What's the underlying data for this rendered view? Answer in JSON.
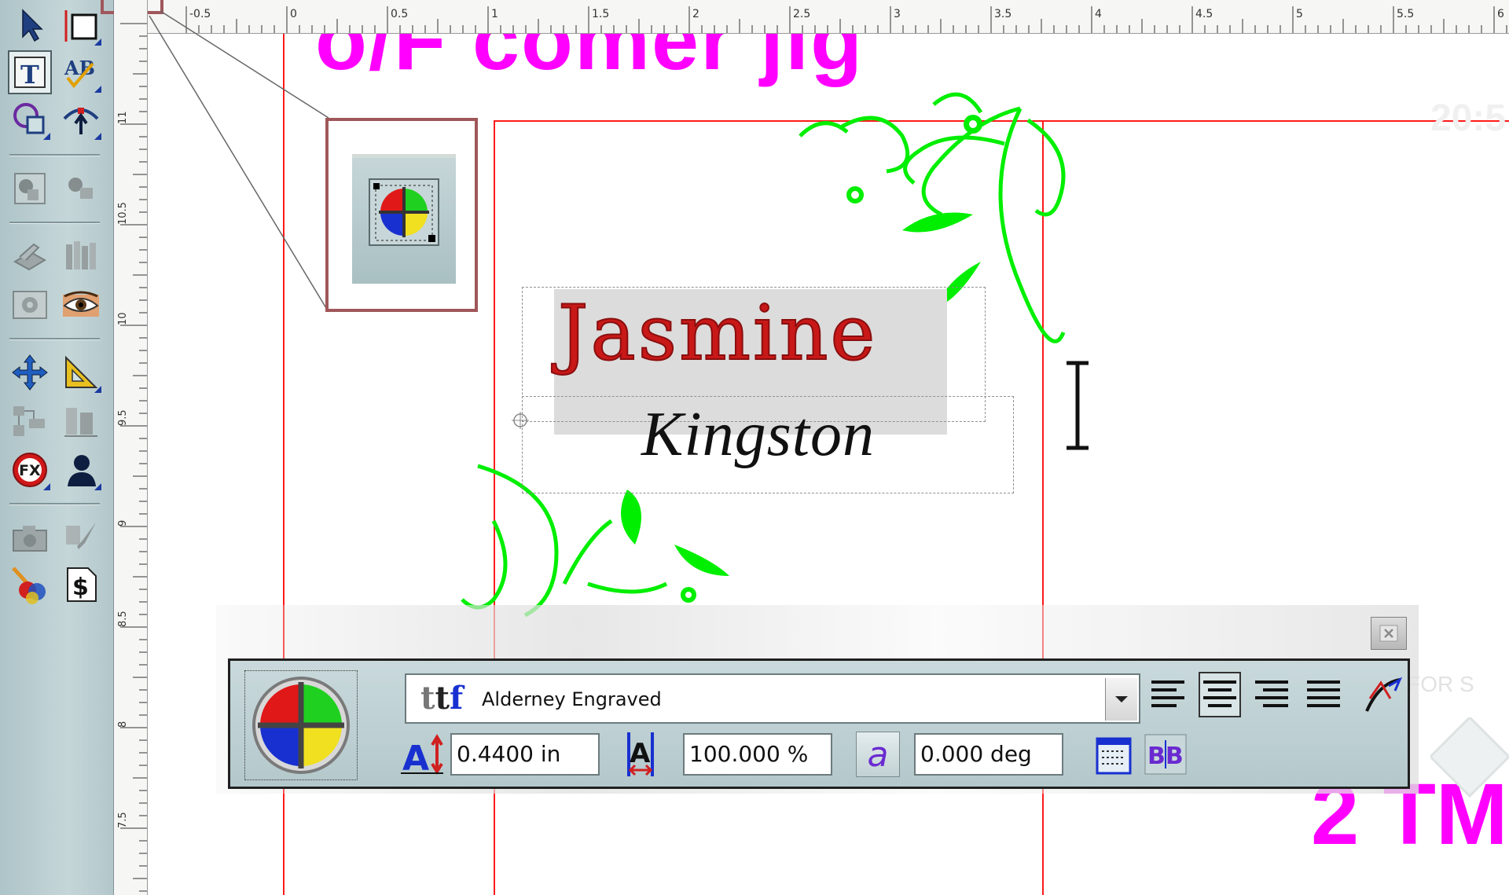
{
  "toolbox": {
    "tools": [
      {
        "name": "select-tool",
        "icon": "arrow-pointer-icon"
      },
      {
        "name": "shape-tool",
        "icon": "rectangle-icon"
      },
      {
        "name": "text-tool",
        "icon": "text-t-icon",
        "active": true,
        "glyph": "T"
      },
      {
        "name": "spell-check-tool",
        "icon": "abc-spell-icon",
        "glyph": "AB"
      },
      {
        "name": "node-edit-tool",
        "icon": "node-edit-icon"
      },
      {
        "name": "add-node-tool",
        "icon": "add-node-icon"
      },
      {
        "name": "group-tool",
        "icon": "group-shapes-icon"
      },
      {
        "name": "ungroup-tool",
        "icon": "ungroup-shapes-icon"
      },
      {
        "name": "scan-tool",
        "icon": "scanner-icon"
      },
      {
        "name": "library-tool",
        "icon": "library-books-icon"
      },
      {
        "name": "gear-tool",
        "icon": "gear-plate-icon"
      },
      {
        "name": "eye-preview-tool",
        "icon": "eye-icon"
      },
      {
        "name": "move-tool",
        "icon": "move-arrows-icon"
      },
      {
        "name": "measure-tool",
        "icon": "triangle-ruler-icon"
      },
      {
        "name": "layout-tool",
        "icon": "layout-grid-icon"
      },
      {
        "name": "align-tool",
        "icon": "align-objects-icon"
      },
      {
        "name": "effects-tool",
        "icon": "fx-icon",
        "glyph": "FX"
      },
      {
        "name": "silhouette-tool",
        "icon": "person-silhouette-icon"
      },
      {
        "name": "camera-tool",
        "icon": "camera-icon"
      },
      {
        "name": "paint-tool",
        "icon": "paintbrush-icon"
      },
      {
        "name": "color-palette-tool",
        "icon": "color-brush-icon"
      },
      {
        "name": "cost-tool",
        "icon": "dollar-doc-icon",
        "glyph": "$"
      }
    ]
  },
  "rulers": {
    "horizontal_labels": [
      "-0.5",
      "0",
      "0.5",
      "1",
      "1.5",
      "2",
      "2.5",
      "3",
      "3.5",
      "4",
      "4.5",
      "5",
      "5.5",
      "6"
    ],
    "vertical_labels": [
      "11",
      "10.5",
      "10",
      "9.5",
      "9",
      "8.5",
      "8",
      "7.5"
    ]
  },
  "canvas": {
    "heading_text": "o/F comer jig",
    "name_text": "Jasmine",
    "surname_text": "Kingston",
    "faded_time": "20:5",
    "faded_note": "OT FOR S",
    "bottom_text": "2 TM",
    "colors": {
      "magenta": "#ff00ff",
      "guide_red": "#ff1a1a",
      "vine_green": "#00ee00",
      "name_red": "#c81818"
    }
  },
  "callout": {
    "icon": "color-palette-button-icon"
  },
  "text_toolbar": {
    "close_icon": "close-icon",
    "palette_icon": "color-wheel-icon",
    "font_type_icon": "truetype-font-icon",
    "font_type_glyph": "ttf",
    "font_name": "Alderney Engraved",
    "alignment_buttons": [
      "align-left",
      "align-center",
      "align-right",
      "align-justify"
    ],
    "active_alignment": "align-center",
    "text_on_path_icon": "text-on-path-icon",
    "height_icon": "text-height-icon",
    "height_value": "0.4400 in",
    "width_icon": "text-width-icon",
    "width_value": "100.000 %",
    "oblique_icon": "italic-a-icon",
    "oblique_glyph": "a",
    "angle_value": "0.000 deg",
    "properties_icon": "text-properties-icon",
    "kerning_icon": "kerning-icon",
    "kerning_glyph": "BB"
  }
}
